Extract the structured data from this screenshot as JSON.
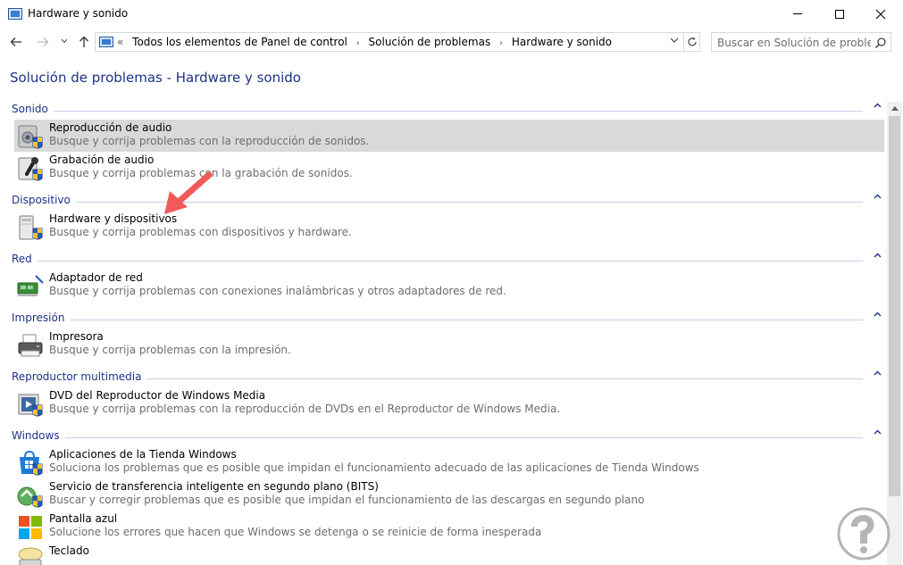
{
  "window": {
    "title": "Hardware y sonido"
  },
  "nav": {
    "breadcrumb": [
      "«",
      "Todos los elementos de Panel de control",
      "Solución de problemas",
      "Hardware y sonido"
    ],
    "search_placeholder": "Buscar en Solución de proble..."
  },
  "page": {
    "title": "Solución de problemas - Hardware y sonido"
  },
  "sections": [
    {
      "label": "Sonido",
      "items": [
        {
          "title": "Reproducción de audio",
          "desc": "Busque y corrija problemas con la reproducción de sonidos.",
          "icon": "speaker-icon",
          "selected": true
        },
        {
          "title": "Grabación de audio",
          "desc": "Busque y corrija problemas con la grabación de sonidos.",
          "icon": "microphone-icon"
        }
      ]
    },
    {
      "label": "Dispositivo",
      "items": [
        {
          "title": "Hardware y dispositivos",
          "desc": "Busque y corrija problemas con dispositivos y hardware.",
          "icon": "hardware-icon"
        }
      ]
    },
    {
      "label": "Red",
      "items": [
        {
          "title": "Adaptador de red",
          "desc": "Busque y corrija problemas con conexiones inalámbricas y otros adaptadores de red.",
          "icon": "network-adapter-icon"
        }
      ]
    },
    {
      "label": "Impresión",
      "items": [
        {
          "title": "Impresora",
          "desc": "Busque y corrija problemas con la impresión.",
          "icon": "printer-icon"
        }
      ]
    },
    {
      "label": "Reproductor multimedia",
      "items": [
        {
          "title": "DVD del Reproductor de Windows Media",
          "desc": "Busque y corrija problemas con la reproducción de DVDs en el Reproductor de Windows Media.",
          "icon": "dvd-icon"
        }
      ]
    },
    {
      "label": "Windows",
      "items": [
        {
          "title": "Aplicaciones de la Tienda Windows",
          "desc": "Soluciona los problemas que es posible que impidan el funcionamiento adecuado de las aplicaciones de Tienda Windows",
          "icon": "store-icon"
        },
        {
          "title": "Servicio de transferencia inteligente en segundo plano (BITS)",
          "desc": "Buscar y corregir problemas que es posible que impidan el funcionamiento de las descargas en segundo plano",
          "icon": "bits-icon"
        },
        {
          "title": "Pantalla azul",
          "desc": "Solucione los errores que hacen que Windows se detenga o se reinicie de forma inesperada",
          "icon": "windows-logo-icon"
        },
        {
          "title": "Teclado",
          "desc": "",
          "icon": "keyboard-icon"
        }
      ]
    }
  ],
  "colors": {
    "link_blue": "#1e3287",
    "selected_bg": "#d9d9d9",
    "desc_gray": "#6d6d6d",
    "annotation_arrow": "#f25a5a"
  }
}
